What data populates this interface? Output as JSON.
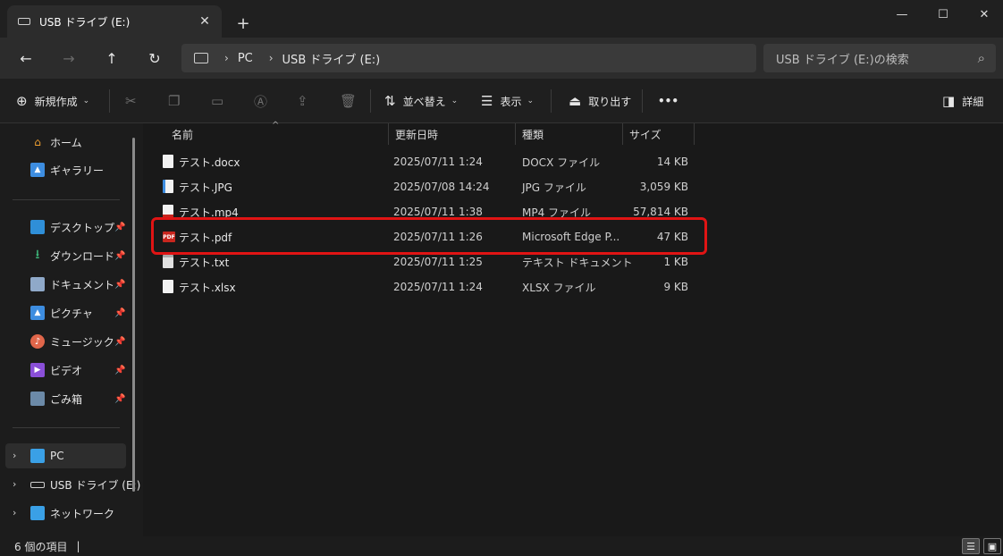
{
  "window": {
    "tab_title": "USB ドライブ (E:)",
    "tab_close": "✕",
    "new_tab": "+",
    "min": "—",
    "max": "☐",
    "close": "✕"
  },
  "nav": {
    "back": "←",
    "forward": "→",
    "up": "↑",
    "refresh": "↻"
  },
  "address": {
    "crumbs": [
      "PC",
      "USB ドライブ (E:)"
    ],
    "chevron": "›"
  },
  "search": {
    "placeholder": "USB ドライブ (E:)の検索",
    "icon": "⌕"
  },
  "toolbar": {
    "new_label": "新規作成",
    "sort_label": "並べ替え",
    "view_label": "表示",
    "eject_label": "取り出す",
    "more_label": "•••",
    "details_label": "詳細"
  },
  "sidebar": {
    "top": [
      {
        "label": "ホーム",
        "icon": "home-icon"
      },
      {
        "label": "ギャラリー",
        "icon": "gallery-icon"
      }
    ],
    "pinned": [
      {
        "label": "デスクトップ",
        "icon": "desktop-icon"
      },
      {
        "label": "ダウンロード",
        "icon": "download-icon"
      },
      {
        "label": "ドキュメント",
        "icon": "document-icon"
      },
      {
        "label": "ピクチャ",
        "icon": "pictures-icon"
      },
      {
        "label": "ミュージック",
        "icon": "music-icon"
      },
      {
        "label": "ビデオ",
        "icon": "video-icon"
      },
      {
        "label": "ごみ箱",
        "icon": "recycle-bin-icon"
      }
    ],
    "tree": [
      {
        "label": "PC",
        "icon": "pc-icon",
        "selected": true
      },
      {
        "label": "USB ドライブ (E:)",
        "icon": "usb-drive-icon"
      },
      {
        "label": "ネットワーク",
        "icon": "network-icon"
      }
    ]
  },
  "columns": {
    "name": "名前",
    "date": "更新日時",
    "type": "種類",
    "size": "サイズ"
  },
  "files": [
    {
      "name": "テスト.docx",
      "date": "2025/07/11 1:24",
      "type": "DOCX ファイル",
      "size": "14 KB"
    },
    {
      "name": "テスト.JPG",
      "date": "2025/07/08 14:24",
      "type": "JPG ファイル",
      "size": "3,059 KB"
    },
    {
      "name": "テスト.mp4",
      "date": "2025/07/11 1:38",
      "type": "MP4 ファイル",
      "size": "57,814 KB"
    },
    {
      "name": "テスト.pdf",
      "date": "2025/07/11 1:26",
      "type": "Microsoft Edge P...",
      "size": "47 KB"
    },
    {
      "name": "テスト.txt",
      "date": "2025/07/11 1:25",
      "type": "テキスト ドキュメント",
      "size": "1 KB"
    },
    {
      "name": "テスト.xlsx",
      "date": "2025/07/11 1:24",
      "type": "XLSX ファイル",
      "size": "9 KB"
    }
  ],
  "pdf_badge": "PDF",
  "status": {
    "count": "6 個の項目",
    "cursor": "|"
  },
  "colors": {
    "highlight": "#e01414",
    "accent": "#4cc2ff"
  }
}
